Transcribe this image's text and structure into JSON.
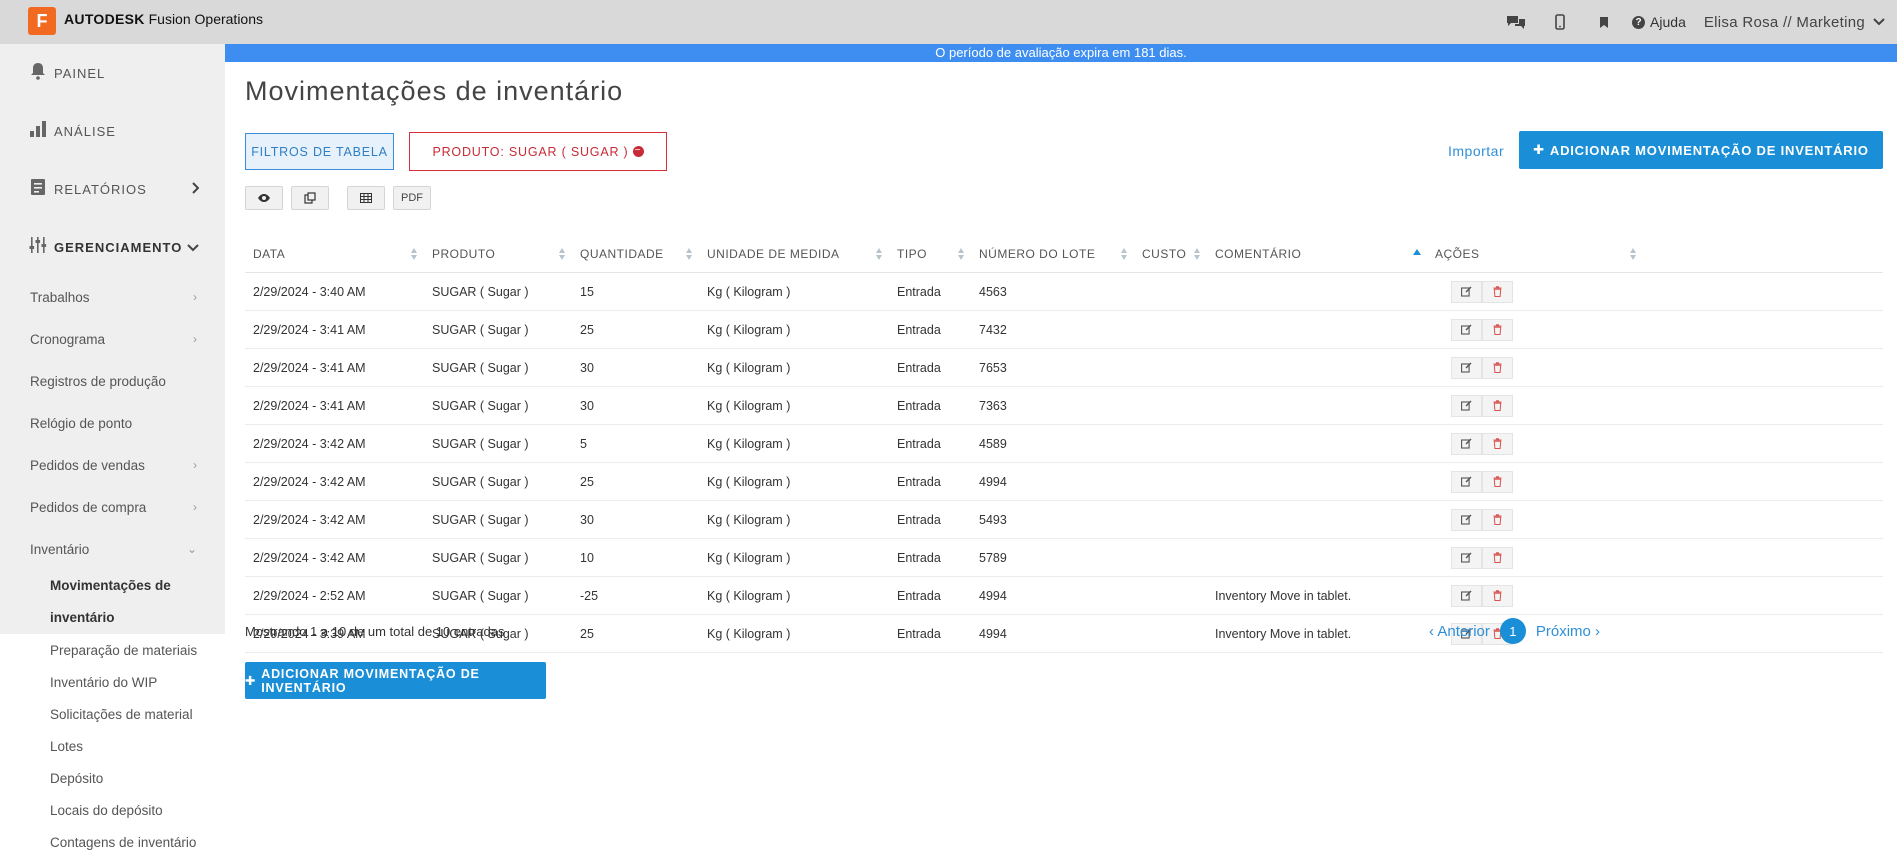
{
  "app": {
    "logo_letter": "F",
    "brand_bold": "AUTODESK",
    "brand_rest": "Fusion Operations"
  },
  "topbar": {
    "help_label": "Ajuda",
    "user_label": "Elisa Rosa // Marketing"
  },
  "banner": {
    "text": "O período de avaliação expira em 181 dias."
  },
  "sidebar": {
    "main_items": [
      {
        "label": "PAINEL",
        "icon": "bell-icon"
      },
      {
        "label": "ANÁLISE",
        "icon": "bar-chart-icon"
      },
      {
        "label": "RELATÓRIOS",
        "icon": "report-icon"
      },
      {
        "label": "GERENCIAMENTO",
        "icon": "sliders-icon"
      }
    ],
    "sub_items": [
      {
        "label": "Trabalhos"
      },
      {
        "label": "Cronograma"
      },
      {
        "label": "Registros de produção"
      },
      {
        "label": "Relógio de ponto"
      },
      {
        "label": "Pedidos de vendas"
      },
      {
        "label": "Pedidos de compra"
      },
      {
        "label": "Inventário"
      }
    ],
    "inventory_items": [
      {
        "label_line1": "Movimentações de",
        "label_line2": "inventário"
      },
      {
        "label": "Preparação de materiais"
      },
      {
        "label": "Inventário do WIP"
      },
      {
        "label": "Solicitações de material"
      },
      {
        "label": "Lotes"
      },
      {
        "label": "Depósito"
      },
      {
        "label": "Locais do depósito"
      },
      {
        "label": "Contagens de inventário"
      }
    ]
  },
  "main": {
    "title": "Movimentações de inventário",
    "filters_label": "FILTROS DE TABELA",
    "product_filter_label": "PRODUTO: SUGAR ( SUGAR )",
    "import_label": "Importar",
    "add_label": "ADICIONAR MOVIMENTAÇÃO DE INVENTÁRIO",
    "pdf_label": "PDF",
    "info_text": "Mostrando 1 a 10 de um total de 10 entradas",
    "prev_label": "Anterior",
    "next_label": "Próximo",
    "current_page": "1"
  },
  "table": {
    "columns": [
      "DATA",
      "PRODUTO",
      "QUANTIDADE",
      "UNIDADE DE MEDIDA",
      "TIPO",
      "NÚMERO DO LOTE",
      "CUSTO",
      "COMENTÁRIO",
      "AÇÕES"
    ],
    "rows": [
      [
        "2/29/2024 - 3:40 AM",
        "SUGAR ( Sugar )",
        "15",
        "Kg ( Kilogram )",
        "Entrada",
        "4563",
        "",
        ""
      ],
      [
        "2/29/2024 - 3:41 AM",
        "SUGAR ( Sugar )",
        "25",
        "Kg ( Kilogram )",
        "Entrada",
        "7432",
        "",
        ""
      ],
      [
        "2/29/2024 - 3:41 AM",
        "SUGAR ( Sugar )",
        "30",
        "Kg ( Kilogram )",
        "Entrada",
        "7653",
        "",
        ""
      ],
      [
        "2/29/2024 - 3:41 AM",
        "SUGAR ( Sugar )",
        "30",
        "Kg ( Kilogram )",
        "Entrada",
        "7363",
        "",
        ""
      ],
      [
        "2/29/2024 - 3:42 AM",
        "SUGAR ( Sugar )",
        "5",
        "Kg ( Kilogram )",
        "Entrada",
        "4589",
        "",
        ""
      ],
      [
        "2/29/2024 - 3:42 AM",
        "SUGAR ( Sugar )",
        "25",
        "Kg ( Kilogram )",
        "Entrada",
        "4994",
        "",
        ""
      ],
      [
        "2/29/2024 - 3:42 AM",
        "SUGAR ( Sugar )",
        "30",
        "Kg ( Kilogram )",
        "Entrada",
        "5493",
        "",
        ""
      ],
      [
        "2/29/2024 - 3:42 AM",
        "SUGAR ( Sugar )",
        "10",
        "Kg ( Kilogram )",
        "Entrada",
        "5789",
        "",
        ""
      ],
      [
        "2/29/2024 - 2:52 AM",
        "SUGAR ( Sugar )",
        "-25",
        "Kg ( Kilogram )",
        "Entrada",
        "4994",
        "",
        "Inventory Move in tablet."
      ],
      [
        "2/29/2024 - 3:39 AM",
        "SUGAR ( Sugar )",
        "25",
        "Kg ( Kilogram )",
        "Entrada",
        "4994",
        "",
        "Inventory Move in tablet."
      ]
    ]
  },
  "colors": {
    "accent": "#1a8fd8",
    "danger": "#c82b37",
    "banner": "#3d8ef0",
    "brand": "#f26a22"
  }
}
